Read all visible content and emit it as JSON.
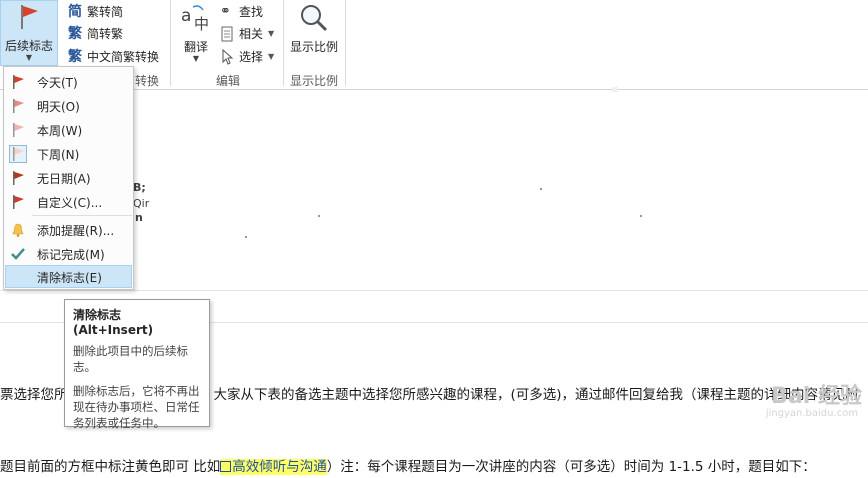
{
  "ribbon": {
    "followup_label": "后续标志",
    "t2s_label": "繁转简",
    "s2t_label": "简转繁",
    "chinese_convert_label": "中文简繁转换",
    "convert_group_suffix": "转换",
    "translate_label": "翻译",
    "find_label": "查找",
    "related_label": "相关",
    "select_label": "选择",
    "edit_group_label": "编辑",
    "zoom_label": "显示比例",
    "zoom_group_label": "显示比例"
  },
  "menu": {
    "items": [
      {
        "label": "今天(T)",
        "icon": "flag-red-icon"
      },
      {
        "label": "明天(O)",
        "icon": "flag-pink-icon"
      },
      {
        "label": "本周(W)",
        "icon": "flag-light-icon"
      },
      {
        "label": "下周(N)",
        "icon": "flag-lightest-icon"
      },
      {
        "label": "无日期(A)",
        "icon": "flag-dark-icon"
      },
      {
        "label": "自定义(C)...",
        "icon": "flag-custom-icon"
      },
      {
        "label": "添加提醒(R)...",
        "icon": "bell-icon"
      },
      {
        "label": "标记完成(M)",
        "icon": "checkmark-icon"
      },
      {
        "label": "清除标志(E)",
        "icon": ""
      }
    ]
  },
  "tooltip": {
    "title": "清除标志 (Alt+Insert)",
    "line1": "删除此项目中的后续标志。",
    "line2": "删除标志后，它将不再出现在待办事项栏、日常任务列表或任务中。"
  },
  "header_fragments": {
    "frag1": "B;",
    "frag2": "Qir",
    "frag3": "n"
  },
  "body": {
    "line1a": "票选择您所",
    "line1b": "大家从下表的备选主题中选择您所感兴趣的课程，(可多选)，通过邮件回复给我（课程主题的详细内容请见附",
    "line2a": "题目前面的方框中标注黄色即可 比如",
    "line2_highlight": "高效倾听与沟通",
    "line2b": "）注：每个课程题目为一次讲座的内容（可多选）时间为 1-1.5 小时，题目如下："
  },
  "watermark": {
    "text": "Bai 经验",
    "sub": "jingyan.baidu.com"
  },
  "colors": {
    "flag_red": "#d8402c",
    "flag_pink": "#e58b86",
    "flag_light": "#efb6b1",
    "flag_lightest": "#f5d2cf",
    "check_teal": "#3f8f8a",
    "selected_bg": "#cde6f7",
    "highlight": "#ffff66"
  }
}
